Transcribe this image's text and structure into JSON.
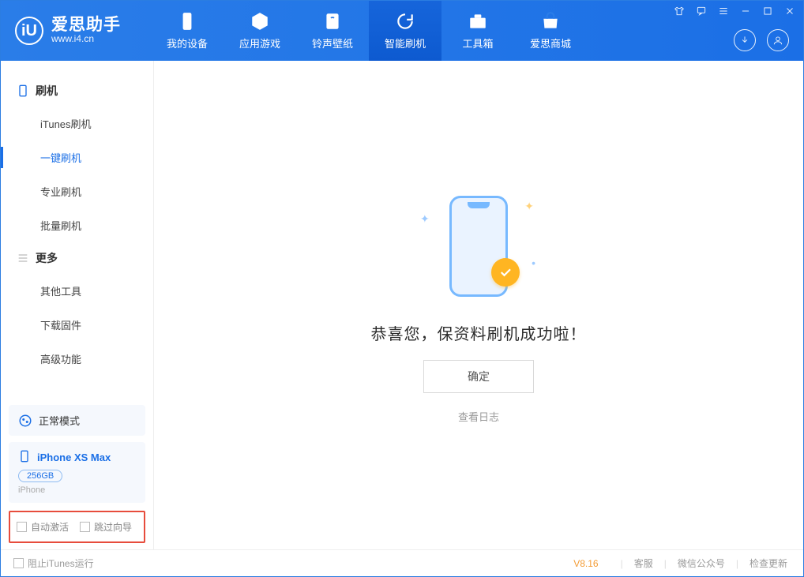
{
  "app": {
    "name_cn": "爱思助手",
    "name_en": "www.i4.cn"
  },
  "tabs": [
    {
      "id": "device",
      "label": "我的设备"
    },
    {
      "id": "apps",
      "label": "应用游戏"
    },
    {
      "id": "ringtone",
      "label": "铃声壁纸"
    },
    {
      "id": "flash",
      "label": "智能刷机"
    },
    {
      "id": "toolbox",
      "label": "工具箱"
    },
    {
      "id": "store",
      "label": "爱思商城"
    }
  ],
  "sidebar": {
    "section1_title": "刷机",
    "section1_items": [
      "iTunes刷机",
      "一键刷机",
      "专业刷机",
      "批量刷机"
    ],
    "section2_title": "更多",
    "section2_items": [
      "其他工具",
      "下载固件",
      "高级功能"
    ]
  },
  "status": {
    "mode": "正常模式"
  },
  "device": {
    "name": "iPhone XS Max",
    "capacity": "256GB",
    "type": "iPhone"
  },
  "bottom_checks": {
    "auto_activate": "自动激活",
    "skip_guide": "跳过向导"
  },
  "main": {
    "message": "恭喜您，保资料刷机成功啦！",
    "ok_btn": "确定",
    "view_log": "查看日志"
  },
  "footer": {
    "block_itunes": "阻止iTunes运行",
    "version": "V8.16",
    "links": [
      "客服",
      "微信公众号",
      "检查更新"
    ]
  }
}
